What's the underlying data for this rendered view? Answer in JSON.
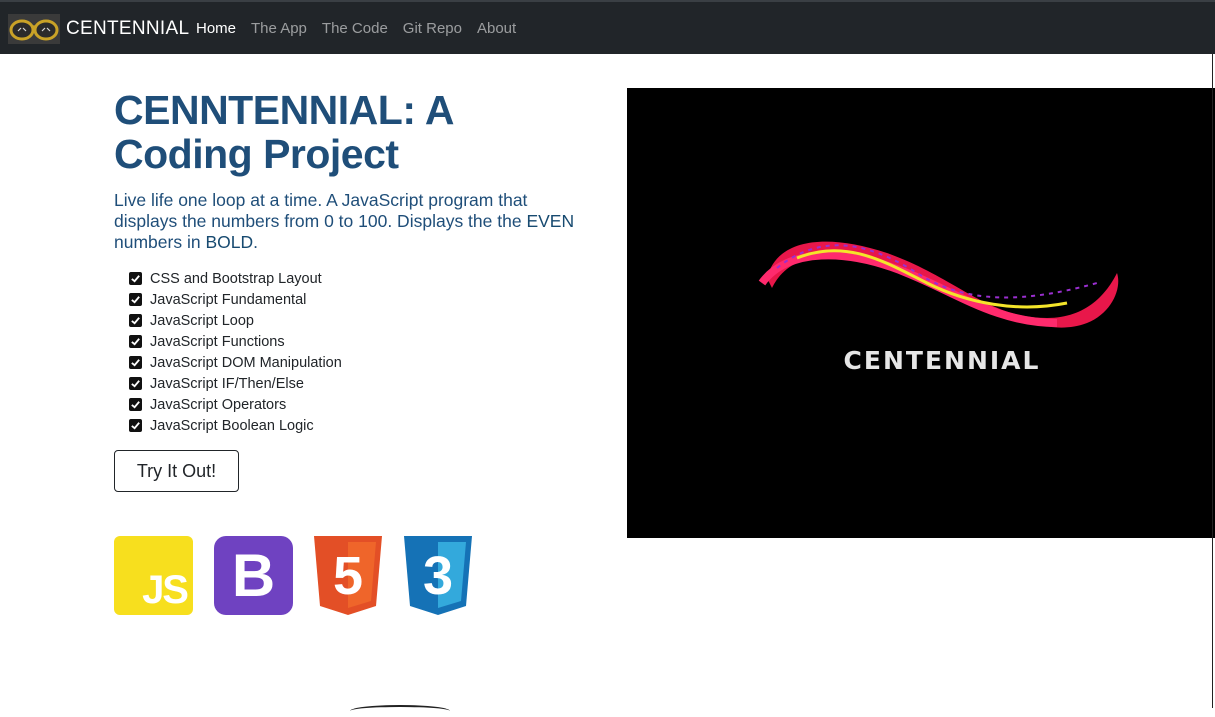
{
  "navbar": {
    "brand_name": "CENTENNIAL",
    "links": [
      {
        "label": "Home",
        "active": true
      },
      {
        "label": "The App",
        "active": false
      },
      {
        "label": "The Code",
        "active": false
      },
      {
        "label": "Git Repo",
        "active": false
      },
      {
        "label": "About",
        "active": false
      }
    ]
  },
  "hero": {
    "title": "CENNTENNIAL: A Coding Project",
    "lead_part1": "Live life one loop at a time. A JavaScript program that displays the numbers from 0 to 100. Displays the the ",
    "lead_even": "EVEN",
    "lead_part2": " numbers in ",
    "lead_bold": "BOLD",
    "lead_end": ".",
    "features": [
      "CSS and Bootstrap Layout",
      "JavaScript Fundamental",
      "JavaScript Loop",
      "JavaScript Functions",
      "JavaScript DOM Manipulation",
      "JavaScript IF/Then/Else",
      "JavaScript Operators",
      "JavaScript Boolean Logic"
    ],
    "button_label": "Try It Out!",
    "image_caption": "CENTENNIAL"
  },
  "tech_logos": {
    "js_text": "JS",
    "bootstrap_text": "B",
    "html_number": "5",
    "css_number": "3",
    "colors": {
      "js": "#f7df1e",
      "bootstrap": "#6f42c1",
      "html": "#e34f26",
      "css": "#1572b6"
    }
  },
  "colors": {
    "navbar": "#212529",
    "title": "#1f4e79"
  }
}
